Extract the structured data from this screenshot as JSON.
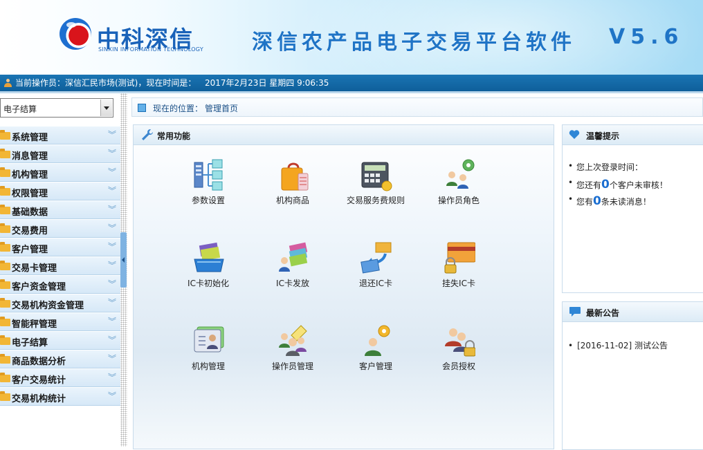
{
  "header": {
    "logo_cn": "中科深信",
    "logo_en": "SINXIN INFORMATION TECHNOLOGY",
    "app_title": "深信农产品电子交易平台软件",
    "app_version": "V5.6"
  },
  "status": {
    "operator_text": "当前操作员：深信汇民市场(测试)，现在时间是：",
    "datetime": "2017年2月23日 星期四 9:06:35"
  },
  "sidebar": {
    "module_select_value": "电子结算",
    "menu": [
      {
        "label": "系统管理"
      },
      {
        "label": "消息管理"
      },
      {
        "label": "机构管理"
      },
      {
        "label": "权限管理"
      },
      {
        "label": "基础数据"
      },
      {
        "label": "交易费用"
      },
      {
        "label": "客户管理"
      },
      {
        "label": "交易卡管理"
      },
      {
        "label": "客户资金管理"
      },
      {
        "label": "交易机构资金管理"
      },
      {
        "label": "智能秤管理"
      },
      {
        "label": "电子结算"
      },
      {
        "label": "商品数据分析"
      },
      {
        "label": "客户交易统计"
      },
      {
        "label": "交易机构统计"
      }
    ]
  },
  "breadcrumb": {
    "label": "现在的位置：",
    "value": "管理首页"
  },
  "functions": {
    "title": "常用功能",
    "tiles": [
      {
        "label": "参数设置",
        "icon": "parameter-settings-icon"
      },
      {
        "label": "机构商品",
        "icon": "shopping-bag-icon"
      },
      {
        "label": "交易服务费规则",
        "icon": "calculator-coin-icon"
      },
      {
        "label": "操作员角色",
        "icon": "users-gear-icon"
      },
      {
        "label": "IC卡初始化",
        "icon": "card-tray-icon"
      },
      {
        "label": "IC卡发放",
        "icon": "card-issue-icon"
      },
      {
        "label": "退还IC卡",
        "icon": "card-return-icon"
      },
      {
        "label": "挂失IC卡",
        "icon": "card-lock-icon"
      },
      {
        "label": "机构管理",
        "icon": "id-card-icon"
      },
      {
        "label": "操作员管理",
        "icon": "operator-group-icon"
      },
      {
        "label": "客户管理",
        "icon": "customer-gear-icon"
      },
      {
        "label": "会员授权",
        "icon": "member-lock-icon"
      }
    ]
  },
  "tips": {
    "title": "温馨提示",
    "last_login": "您上次登录时间：",
    "pending_prefix": "您还有",
    "pending_count": "0",
    "pending_suffix": "个客户未审核！",
    "unread_prefix": "您有",
    "unread_count": "0",
    "unread_suffix": "条未读消息！"
  },
  "notices": {
    "title": "最新公告",
    "items": [
      {
        "text": "[2016-11-02] 测试公告"
      }
    ]
  }
}
